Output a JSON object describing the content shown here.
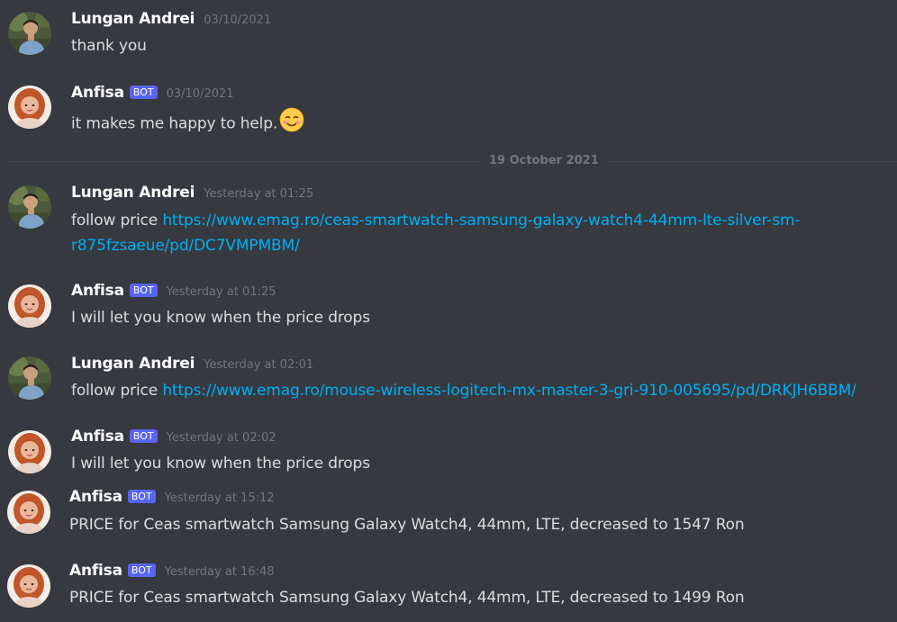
{
  "colors": {
    "background": "#36393f",
    "username": "#ffffff",
    "message_text": "#dcddde",
    "timestamp": "#72767d",
    "link": "#00aff4",
    "bot_badge": "#5865f2"
  },
  "divider": {
    "label": "19 October 2021"
  },
  "messages": [
    {
      "author": "Lungan Andrei",
      "bot": false,
      "timestamp": "03/10/2021",
      "text": "thank you",
      "avatar_icon": "man-portrait-avatar"
    },
    {
      "author": "Anfisa",
      "bot": true,
      "bot_label": "BOT",
      "timestamp": "03/10/2021",
      "text": "it makes me happy to help.",
      "emoji": "smiling-face-emoji",
      "avatar_icon": "woman-portrait-avatar"
    },
    {
      "author": "Lungan Andrei",
      "bot": false,
      "timestamp": "Yesterday at 01:25",
      "text": "follow price ",
      "link_line1": "https://www.emag.ro/ceas-smartwatch-samsung-galaxy-watch4-44mm-lte-silver-sm-",
      "link_line2": "r875fzsaeue/pd/DC7VMPMBM/",
      "avatar_icon": "man-portrait-avatar"
    },
    {
      "author": "Anfisa",
      "bot": true,
      "bot_label": "BOT",
      "timestamp": "Yesterday at 01:25",
      "text": "I will let you know when the price drops",
      "avatar_icon": "woman-portrait-avatar"
    },
    {
      "author": "Lungan Andrei",
      "bot": false,
      "timestamp": "Yesterday at 02:01",
      "text": "follow price ",
      "link_line1": "https://www.emag.ro/mouse-wireless-logitech-mx-master-3-gri-910-005695/pd/DRKJH6BBM/",
      "avatar_icon": "man-portrait-avatar"
    },
    {
      "author": "Anfisa",
      "bot": true,
      "bot_label": "BOT",
      "timestamp": "Yesterday at 02:02",
      "text": "I will let you know when the price drops",
      "avatar_icon": "woman-portrait-avatar"
    },
    {
      "author": "Anfisa",
      "bot": true,
      "bot_label": "BOT",
      "timestamp": "Yesterday at 15:12",
      "text": "PRICE for Ceas smartwatch Samsung Galaxy Watch4, 44mm, LTE,  decreased to 1547 Ron",
      "avatar_icon": "woman-portrait-avatar"
    },
    {
      "author": "Anfisa",
      "bot": true,
      "bot_label": "BOT",
      "timestamp": "Yesterday at 16:48",
      "text": "PRICE for Ceas smartwatch Samsung Galaxy Watch4, 44mm, LTE,  decreased to 1499 Ron",
      "avatar_icon": "woman-portrait-avatar"
    }
  ]
}
